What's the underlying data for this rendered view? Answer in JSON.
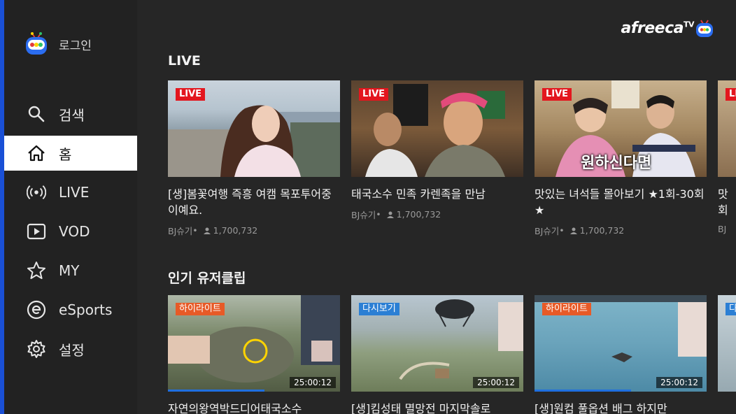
{
  "sidebar": {
    "login_label": "로그인",
    "items": [
      {
        "label": "검색",
        "icon": "search-icon"
      },
      {
        "label": "홈",
        "icon": "home-icon",
        "active": true
      },
      {
        "label": "LIVE",
        "icon": "broadcast-icon"
      },
      {
        "label": "VOD",
        "icon": "play-icon"
      },
      {
        "label": "MY",
        "icon": "star-icon"
      },
      {
        "label": "eSports",
        "icon": "esports-icon"
      },
      {
        "label": "설정",
        "icon": "gear-icon"
      }
    ]
  },
  "brand": {
    "name": "afreeca",
    "suffix": "TV"
  },
  "colors": {
    "accent": "#1a50d6",
    "live_badge": "#e3161e",
    "highlight_badge": "#e75a27",
    "replay_badge": "#2b7fd4"
  },
  "sections": [
    {
      "title": "LIVE",
      "cards": [
        {
          "badge": "LIVE",
          "title": "[생]봄꽃여행 즉흥 여캠 목포투어중이예요.",
          "channel": "BJ슈기",
          "viewers": "1,700,732"
        },
        {
          "badge": "LIVE",
          "title": "태국소수 민족 카렌족을 만남",
          "channel": "BJ슈기",
          "viewers": "1,700,732"
        },
        {
          "badge": "LIVE",
          "title": "맛있는 녀석들 몰아보기 ★1회-30회★",
          "channel": "BJ슈기",
          "viewers": "1,700,732",
          "thumb_caption": "원하신다면"
        },
        {
          "badge": "LIVE",
          "title": "맛회",
          "channel": "BJ",
          "viewers": ""
        }
      ]
    },
    {
      "title": "인기 유저클립",
      "cards": [
        {
          "badge": "하이라이트",
          "title": "자연의왕역박드디어태국소수",
          "duration": "25:00:12",
          "progress": 0.56
        },
        {
          "badge": "다시보기",
          "title": "[생]킴성태 멸망전 마지막솔로",
          "duration": "25:00:12",
          "progress": 0
        },
        {
          "badge": "하이라이트",
          "title": "[생]원컴 풀옵션 배그 하지만",
          "duration": "25:00:12",
          "progress": 0.56
        },
        {
          "badge": "다",
          "title": "",
          "duration": "",
          "progress": 0
        }
      ]
    }
  ]
}
